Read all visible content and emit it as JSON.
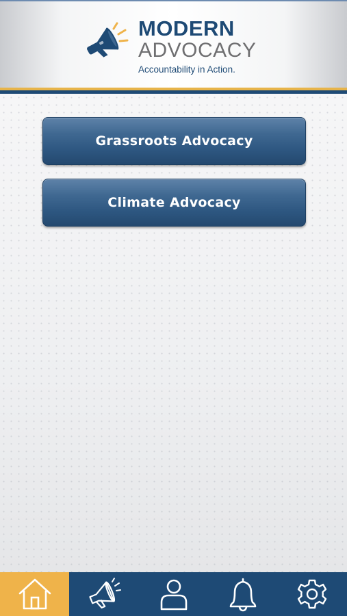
{
  "header": {
    "logo_line1": "MODERN",
    "logo_line2": "ADVOCACY",
    "tagline": "Accountability in Action.",
    "logo_icon": "megaphone-icon"
  },
  "menu": {
    "buttons": [
      {
        "label": "Grassroots Advocacy"
      },
      {
        "label": "Climate Advocacy"
      }
    ]
  },
  "tabbar": {
    "active_index": 0,
    "tabs": [
      {
        "icon": "home-icon"
      },
      {
        "icon": "megaphone-icon"
      },
      {
        "icon": "profile-icon"
      },
      {
        "icon": "bell-icon"
      },
      {
        "icon": "gear-icon"
      }
    ]
  },
  "colors": {
    "brand_navy": "#1e4a75",
    "accent_gold": "#efb34a",
    "logo_gray": "#6f6f71"
  }
}
